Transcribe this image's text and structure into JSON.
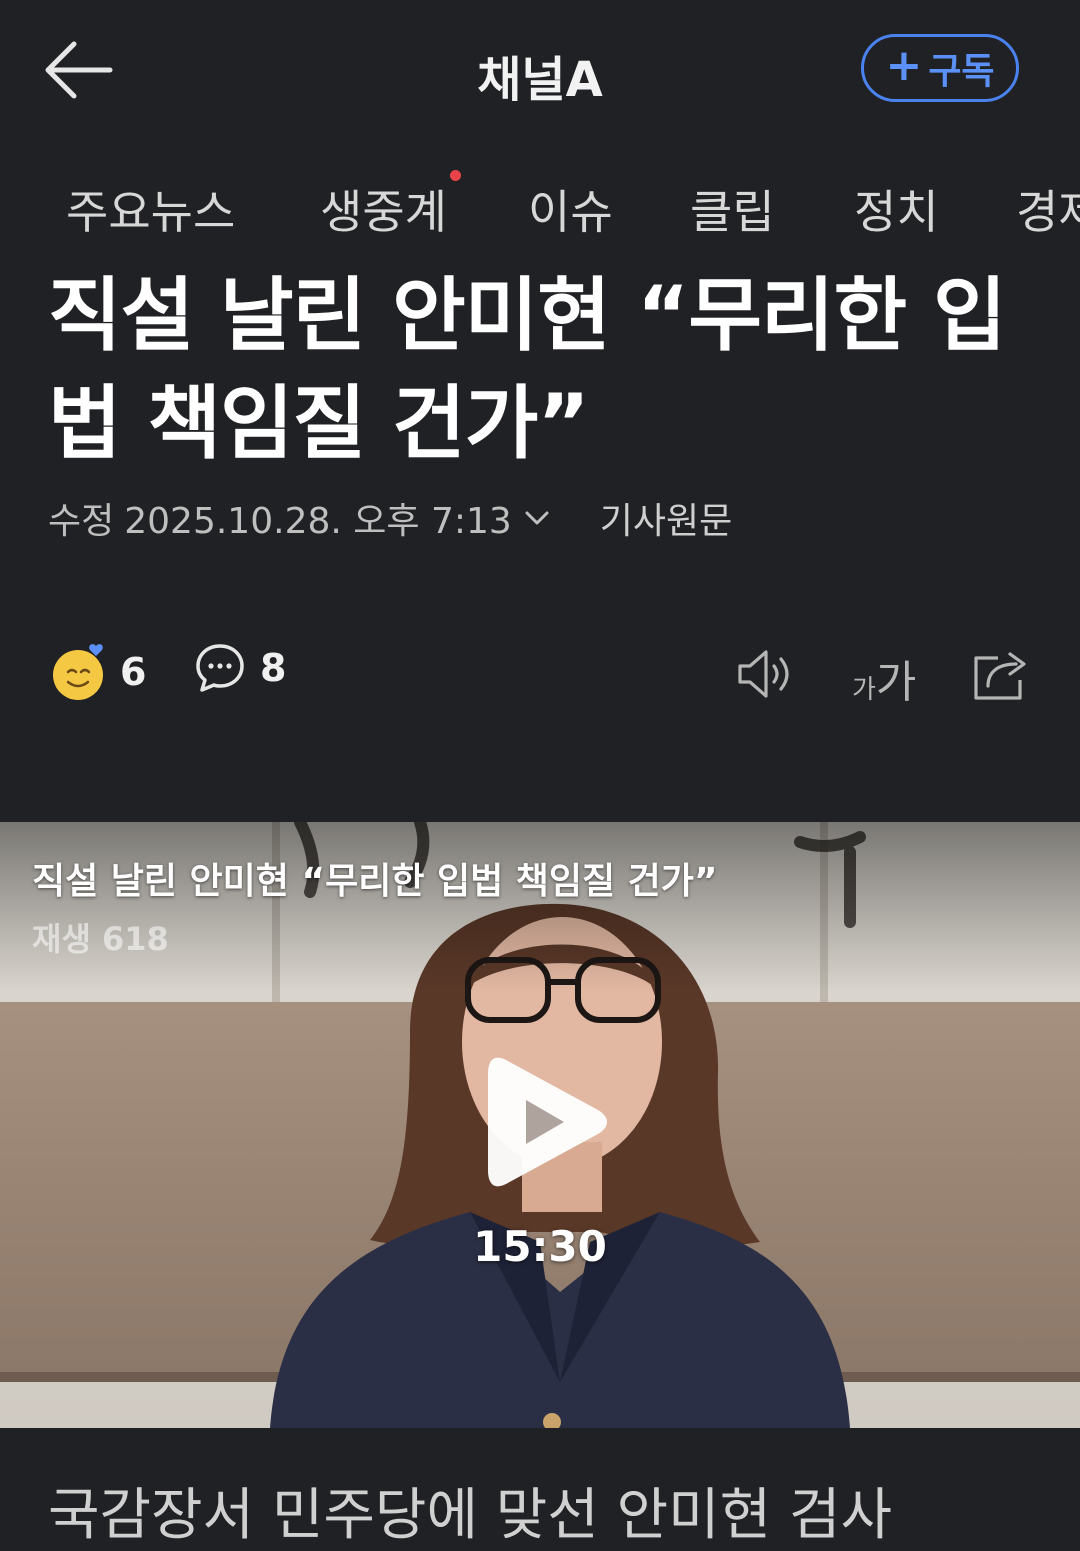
{
  "header": {
    "channel_name": "채널A",
    "subscribe_label": "구독",
    "subscribe_plus": "+"
  },
  "tabs": [
    {
      "label": "주요뉴스",
      "badge": false
    },
    {
      "label": "생중계",
      "badge": true
    },
    {
      "label": "이슈",
      "badge": false
    },
    {
      "label": "클립",
      "badge": false
    },
    {
      "label": "정치",
      "badge": false
    },
    {
      "label": "경제",
      "badge": false
    }
  ],
  "article": {
    "headline_line1": "직설 날린 안미현 “무리한 입",
    "headline_line2": "법 책임질 건가”",
    "modified_label": "수정",
    "timestamp": "2025.10.28. 오후 7:13",
    "source_link": "기사원문",
    "reaction_count": "6",
    "comment_count": "8",
    "font_size_label_small": "가",
    "font_size_label_large": "가",
    "subheading": "국감장서 민주당에 맞선 안미현 검사"
  },
  "video": {
    "title": "직설 날린 안미현 “무리한 입법 책임질 건가”",
    "views": "재생 618",
    "duration": "15:30"
  },
  "icons": {
    "back": "back-arrow-icon",
    "reaction": "smiley-reaction-icon",
    "comment": "speech-bubble-icon",
    "audio": "speaker-icon",
    "font_size": "font-size-icon",
    "share": "share-icon",
    "play": "play-icon"
  },
  "colors": {
    "background": "#202124",
    "accent_blue": "#4a82f0",
    "live_dot": "#e8434a"
  }
}
